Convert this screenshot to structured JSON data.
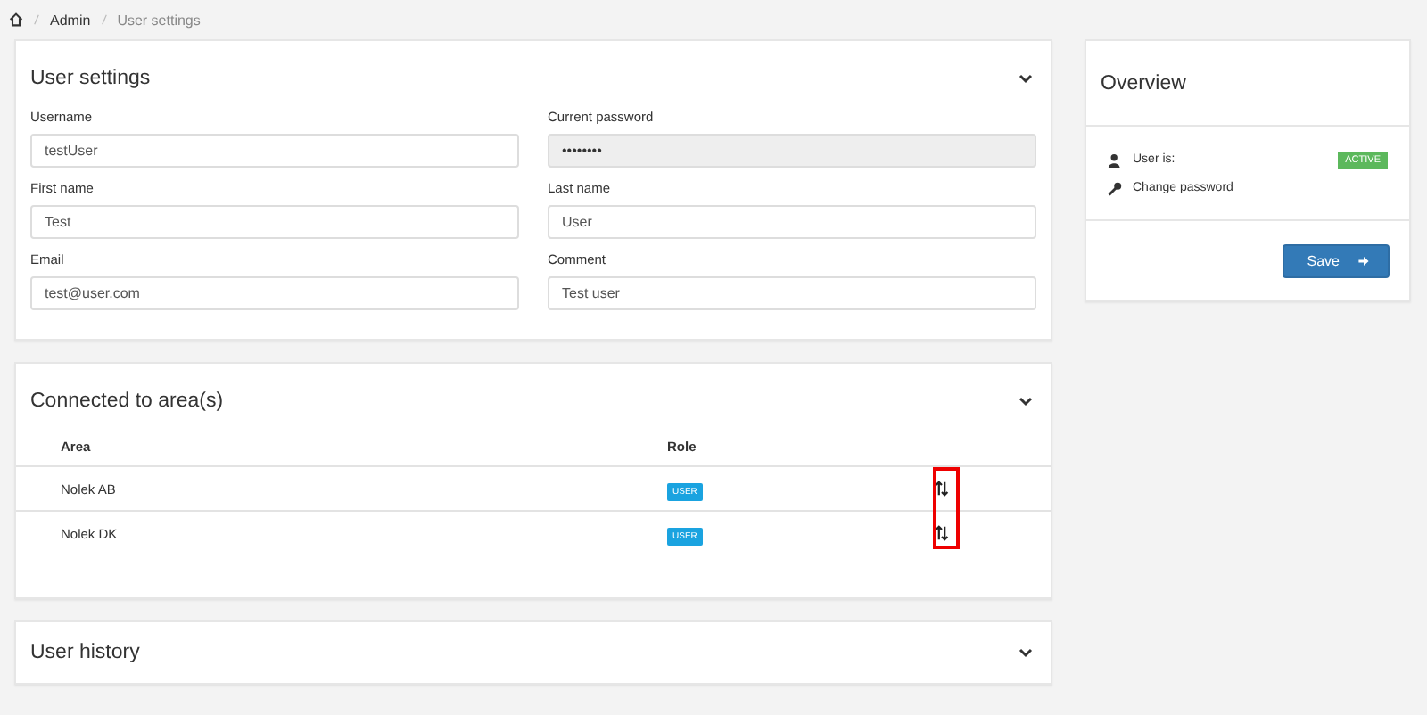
{
  "breadcrumb": [
    "Admin",
    "User settings"
  ],
  "user_settings": {
    "title": "User settings",
    "fields": [
      {
        "label": "Username",
        "value": "testUser",
        "disabled": false
      },
      {
        "label": "Current password",
        "value": "••••••••",
        "disabled": true
      },
      {
        "label": "First name",
        "value": "Test",
        "disabled": false
      },
      {
        "label": "Last name",
        "value": "User",
        "disabled": false
      },
      {
        "label": "Email",
        "value": "test@user.com",
        "disabled": false
      },
      {
        "label": "Comment",
        "value": "Test user",
        "disabled": false
      }
    ]
  },
  "areas": {
    "title": "Connected to area(s)",
    "columns": [
      "Area",
      "Role"
    ],
    "rows": [
      {
        "area": "Nolek AB",
        "role": "USER"
      },
      {
        "area": "Nolek DK",
        "role": "USER"
      }
    ]
  },
  "history": {
    "title": "User history"
  },
  "overview": {
    "title": "Overview",
    "status_label": "User is:",
    "status": "ACTIVE",
    "change_password": "Change password",
    "save": "Save"
  }
}
